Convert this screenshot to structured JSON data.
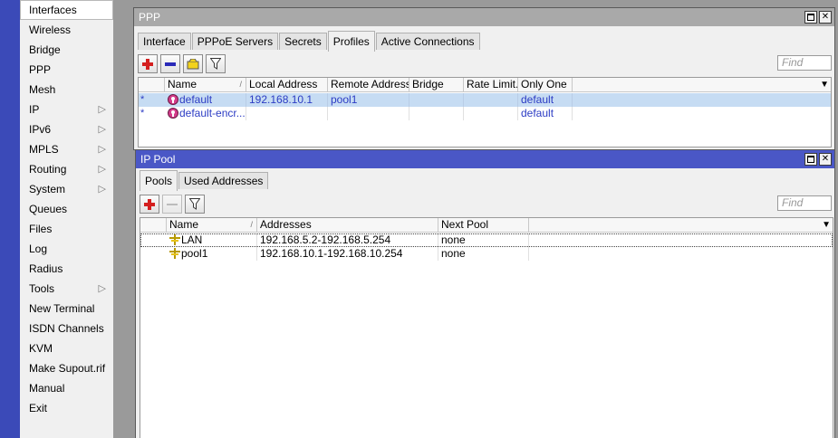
{
  "sidebar": {
    "items": [
      {
        "label": "Interfaces",
        "submenu": false,
        "selected": true
      },
      {
        "label": "Wireless",
        "submenu": false
      },
      {
        "label": "Bridge",
        "submenu": false
      },
      {
        "label": "PPP",
        "submenu": false
      },
      {
        "label": "Mesh",
        "submenu": false
      },
      {
        "label": "IP",
        "submenu": true
      },
      {
        "label": "IPv6",
        "submenu": true
      },
      {
        "label": "MPLS",
        "submenu": true
      },
      {
        "label": "Routing",
        "submenu": true
      },
      {
        "label": "System",
        "submenu": true
      },
      {
        "label": "Queues",
        "submenu": false
      },
      {
        "label": "Files",
        "submenu": false
      },
      {
        "label": "Log",
        "submenu": false
      },
      {
        "label": "Radius",
        "submenu": false
      },
      {
        "label": "Tools",
        "submenu": true
      },
      {
        "label": "New Terminal",
        "submenu": false
      },
      {
        "label": "ISDN Channels",
        "submenu": false
      },
      {
        "label": "KVM",
        "submenu": false
      },
      {
        "label": "Make Supout.rif",
        "submenu": false
      },
      {
        "label": "Manual",
        "submenu": false
      },
      {
        "label": "Exit",
        "submenu": false
      }
    ],
    "submenu_glyph": "▷"
  },
  "ppp_window": {
    "title": "PPP",
    "tabs": [
      "Interface",
      "PPPoE Servers",
      "Secrets",
      "Profiles",
      "Active Connections"
    ],
    "active_tab": "Profiles",
    "find_placeholder": "Find",
    "columns": [
      "Name",
      "Local Address",
      "Remote Address",
      "Bridge",
      "Rate Limit...",
      "Only One"
    ],
    "sort_mark": "/",
    "rows": [
      {
        "flag": "*",
        "name": "default",
        "local_address": "192.168.10.1",
        "remote_address": "pool1",
        "bridge": "",
        "rate_limit": "",
        "only_one": "default",
        "selected": true
      },
      {
        "flag": "*",
        "name": "default-encr...",
        "local_address": "",
        "remote_address": "",
        "bridge": "",
        "rate_limit": "",
        "only_one": "default",
        "selected": false
      }
    ]
  },
  "ip_pool_window": {
    "title": "IP Pool",
    "tabs": [
      "Pools",
      "Used Addresses"
    ],
    "active_tab": "Pools",
    "find_placeholder": "Find",
    "columns": [
      "Name",
      "Addresses",
      "Next Pool"
    ],
    "sort_mark": "/",
    "rows": [
      {
        "name": "LAN",
        "addresses": "192.168.5.2-192.168.5.254",
        "next_pool": "none"
      },
      {
        "name": "pool1",
        "addresses": "192.168.10.1-192.168.10.254",
        "next_pool": "none"
      }
    ]
  },
  "colors": {
    "title_active": "#4a57c6",
    "title_inactive": "#a9a9a9",
    "side_strip": "#3b4ab8",
    "row_selected": "#c6dcf3",
    "link_text": "#2c3cc4"
  }
}
